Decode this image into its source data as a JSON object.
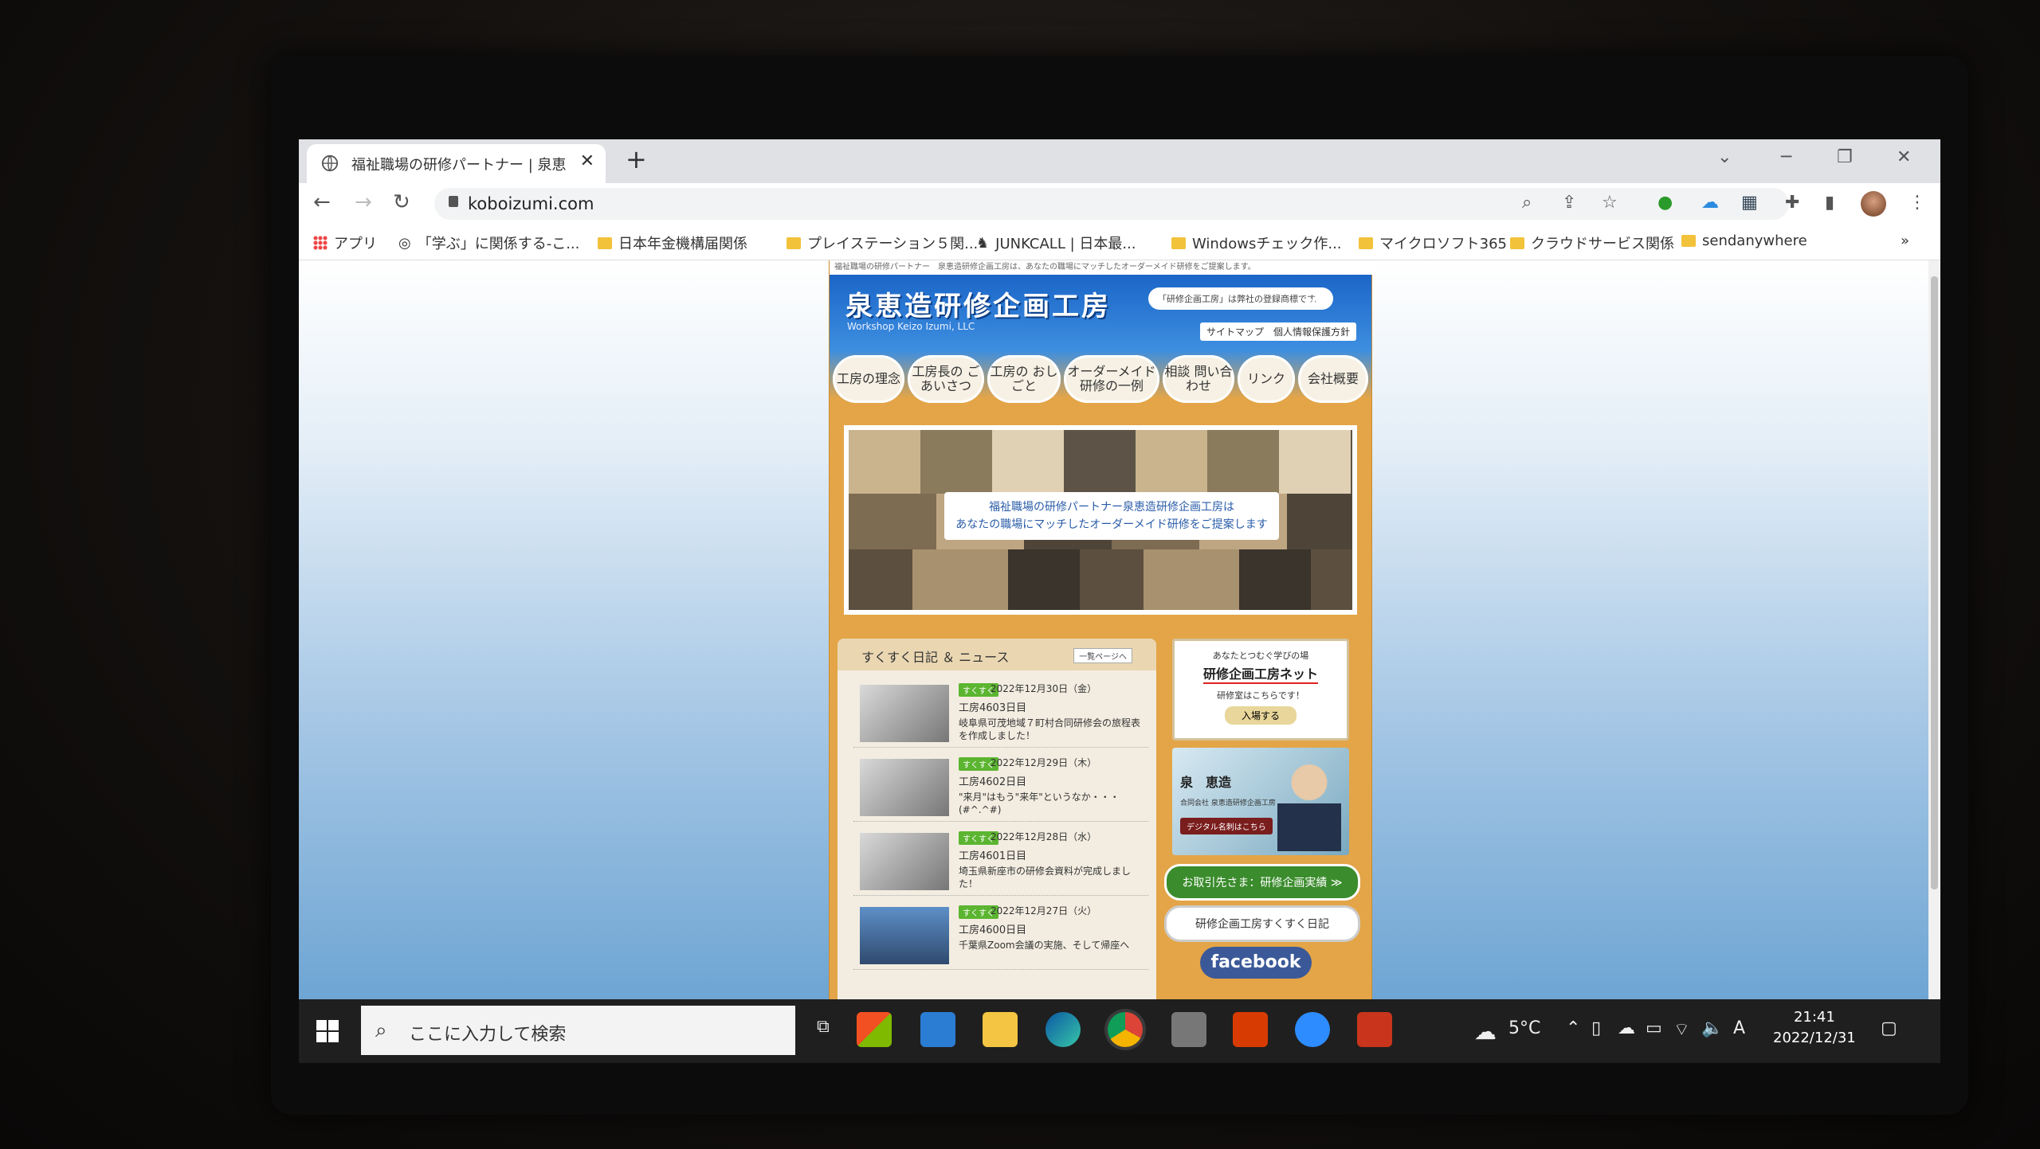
{
  "browser": {
    "tab_title": "福祉職場の研修パートナー | 泉恵造",
    "url": "koboizumi.com",
    "bookmarks": [
      {
        "label": "アプリ",
        "icon": "apps-icon"
      },
      {
        "label": "「学ぶ」に関係する-こ...",
        "icon": "globe-icon"
      },
      {
        "label": "日本年金機構届関係",
        "icon": "folder-icon"
      },
      {
        "label": "プレイステーション５関...",
        "icon": "folder-icon"
      },
      {
        "label": "JUNKCALL | 日本最...",
        "icon": "site-icon"
      },
      {
        "label": "Windowsチェック作...",
        "icon": "folder-icon"
      },
      {
        "label": "マイクロソフト365",
        "icon": "folder-icon"
      },
      {
        "label": "クラウドサービス関係",
        "icon": "folder-icon"
      },
      {
        "label": "sendanywhere",
        "icon": "folder-icon"
      }
    ],
    "overflow": "»"
  },
  "site": {
    "topline": "福祉職場の研修パートナー　泉恵造研修企画工房は、あなたの職場にマッチしたオーダーメイド研修をご提案します。",
    "logo": "泉恵造研修企画工房",
    "logo_sub": "Workshop Keizo Izumi, LLC",
    "cloud_text": "「研修企画工房」は弊社の登録商標です。",
    "site_links": "サイトマップ　個人情報保護方針",
    "menu": [
      {
        "label": "工房の理念"
      },
      {
        "label": "工房長の ごあいさつ"
      },
      {
        "label": "工房の おしごと"
      },
      {
        "label": "オーダーメイド 研修の一例"
      },
      {
        "label": "相談 問い合わせ"
      },
      {
        "label": "リンク"
      },
      {
        "label": "会社概要"
      }
    ],
    "hero_caption_1": "福祉職場の研修パートナー泉恵造研修企画工房は",
    "hero_caption_2": "あなたの職場にマッチしたオーダーメイド研修をご提案します",
    "news_title": "すくすく日記 ＆ ニュース",
    "news_more": "一覧ページへ",
    "news": [
      {
        "tag": "すくすく",
        "date": "2022年12月30日（金）",
        "day": "工房4603日目",
        "text": "岐阜県可茂地域７町村合同研修会の旅程表を作成しました！"
      },
      {
        "tag": "すくすく",
        "date": "2022年12月29日（木）",
        "day": "工房4602日目",
        "text": "\"来月\"はもう\"来年\"というなか・・・(#^.^#)"
      },
      {
        "tag": "すくすく",
        "date": "2022年12月28日（水）",
        "day": "工房4601日目",
        "text": "埼玉県新座市の研修会資料が完成しました！"
      },
      {
        "tag": "すくすく",
        "date": "2022年12月27日（火）",
        "day": "工房4600日目",
        "text": "千葉県Zoom会議の実施、そして帰座へ"
      }
    ],
    "card1_a": "あなたとつむぐ学びの場",
    "card1_b": "研修企画工房ネット",
    "card1_c": "研修室はこちらです！",
    "card1_d": "入場する",
    "card2_name": "泉　恵造",
    "card2_sub": "合同会社 泉恵造研修企画工房",
    "card2_btn": "デジタル名刺はこちら",
    "pill1": "お取引先さま：研修企画実績 ≫",
    "pill2": "研修企画工房すくすく日記",
    "fb": "facebook"
  },
  "taskbar": {
    "search_placeholder": "ここに入力して検索",
    "weather": "5°C",
    "time": "21:41",
    "date": "2022/12/31",
    "ime": "A"
  }
}
